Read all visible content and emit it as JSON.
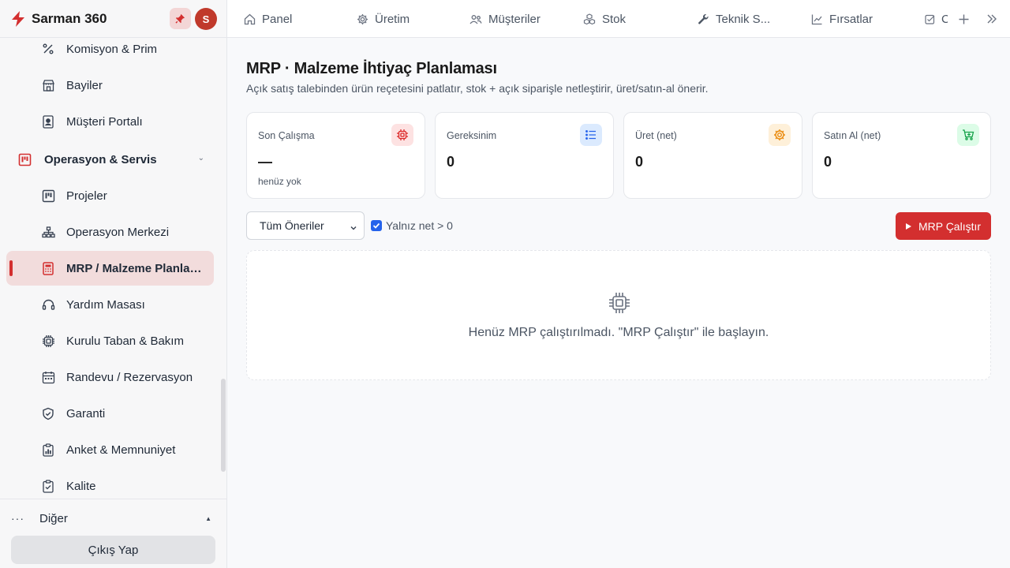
{
  "brand": {
    "name": "Sarman 360",
    "avatar_initial": "S",
    "accent": "#d32f2f"
  },
  "sidebar": {
    "items": [
      {
        "label": "Komisyon & Prim",
        "icon": "percent-icon"
      },
      {
        "label": "Bayiler",
        "icon": "store-icon"
      },
      {
        "label": "Müşteri Portalı",
        "icon": "portrait-icon"
      },
      {
        "label": "Operasyon & Servis",
        "icon": "operations-icon"
      },
      {
        "label": "Projeler",
        "icon": "kanban-icon"
      },
      {
        "label": "Operasyon Merkezi",
        "icon": "hierarchy-icon"
      },
      {
        "label": "MRP / Malzeme Planlaması",
        "icon": "calculator-icon"
      },
      {
        "label": "Yardım Masası",
        "icon": "headset-icon"
      },
      {
        "label": "Kurulu Taban & Bakım",
        "icon": "chip-icon"
      },
      {
        "label": "Randevu / Rezervasyon",
        "icon": "calendar-icon"
      },
      {
        "label": "Garanti",
        "icon": "shield-icon"
      },
      {
        "label": "Anket & Memnuniyet",
        "icon": "survey-icon"
      },
      {
        "label": "Kalite",
        "icon": "clipboard-check-icon"
      }
    ],
    "other_label": "Diğer",
    "logout_label": "Çıkış Yap"
  },
  "tabs": [
    {
      "label": "Panel",
      "icon": "home-icon"
    },
    {
      "label": "Üretim",
      "icon": "gear-icon"
    },
    {
      "label": "Müşteriler",
      "icon": "users-icon"
    },
    {
      "label": "Stok",
      "icon": "boxes-icon"
    },
    {
      "label": "Teknik S...",
      "icon": "wrench-icon"
    },
    {
      "label": "Fırsatlar",
      "icon": "chart-line-icon"
    },
    {
      "label": "C",
      "icon": "checkbox-icon"
    }
  ],
  "page": {
    "title": "MRP · Malzeme İhtiyaç Planlaması",
    "subtitle": "Açık satış talebinden ürün reçetesini patlatır, stok + açık siparişle netleştirir, üret/satın-al önerir."
  },
  "cards": [
    {
      "title": "Son Çalışma",
      "value": "—",
      "sub": "henüz yok",
      "icon": "chip-icon",
      "color": "#dc2626",
      "bg": "#fde2e2"
    },
    {
      "title": "Gereksinim",
      "value": "0",
      "sub": "",
      "icon": "list-icon",
      "color": "#2563eb",
      "bg": "#dbeafe"
    },
    {
      "title": "Üret (net)",
      "value": "0",
      "sub": "",
      "icon": "gear-icon",
      "color": "#ea8a0c",
      "bg": "#fef0d9"
    },
    {
      "title": "Satın Al (net)",
      "value": "0",
      "sub": "",
      "icon": "cart-icon",
      "color": "#16a34a",
      "bg": "#dcfce7"
    }
  ],
  "filters": {
    "select_value": "Tüm Öneriler",
    "checkbox_label": "Yalnız net > 0",
    "checkbox_checked": true
  },
  "run_button": "MRP Çalıştır",
  "empty_state": "Henüz MRP çalıştırılmadı. \"MRP Çalıştır\" ile başlayın."
}
